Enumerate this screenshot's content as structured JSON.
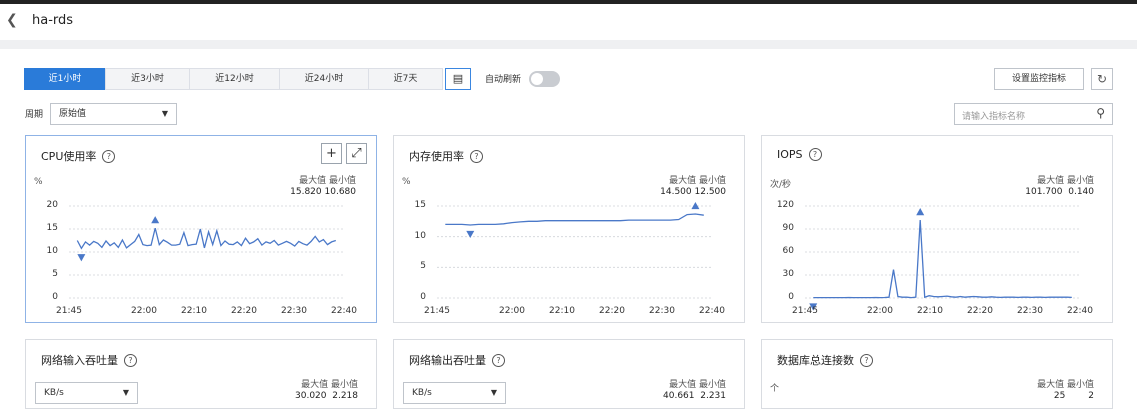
{
  "header": {
    "title": "ha-rds",
    "back_icon": "chevron-left-icon"
  },
  "toolbar": {
    "time_ranges": [
      "近1小时",
      "近3小时",
      "近12小时",
      "近24小时",
      "近7天"
    ],
    "active_range": "近1小时",
    "auto_refresh_label": "自动刷新",
    "auto_refresh_on": false,
    "settings_label": "设置监控指标",
    "period_label": "周期",
    "period_value": "原始值",
    "search_placeholder": "请输入指标名称"
  },
  "labels": {
    "max": "最大值",
    "min": "最小值"
  },
  "cards": [
    {
      "title": "CPU使用率",
      "unit": "%",
      "max": "15.820",
      "min": "10.680",
      "chart_data": {
        "type": "line",
        "x_ticks": [
          "21:45",
          "22:00",
          "22:10",
          "22:20",
          "22:30",
          "22:40"
        ],
        "y_ticks": [
          "20",
          "15",
          "10",
          "5",
          "0"
        ],
        "ylim": [
          0,
          20
        ],
        "series": [
          {
            "values": [
              12.5,
              10.8,
              12.2,
              11.5,
              12.3,
              11.9,
              11.0,
              12.4,
              11.4,
              12.0,
              11.0,
              12.6,
              10.9,
              11.6,
              12.3,
              13.8,
              11.6,
              11.4,
              11.5,
              15.2,
              11.6,
              12.6,
              12.1,
              11.5,
              11.5,
              11.7,
              14.2,
              11.4,
              11.6,
              11.7,
              15.0,
              10.9,
              14.4,
              11.6,
              14.6,
              11.4,
              12.4,
              11.7,
              11.6,
              12.2,
              11.4,
              13.0,
              11.8,
              12.2,
              12.9,
              11.5,
              12.2,
              11.9,
              12.5,
              11.5,
              11.9,
              12.3,
              11.9,
              11.3,
              12.3,
              11.8,
              11.5,
              12.3,
              13.4,
              12.2,
              12.7,
              11.6,
              12.2,
              12.5
            ]
          }
        ],
        "max_marker_x": "22:06",
        "min_marker_x": "21:49",
        "grid": "dashed-horizontal"
      }
    },
    {
      "title": "内存使用率",
      "unit": "%",
      "max": "14.500",
      "min": "12.500",
      "chart_data": {
        "type": "line",
        "x_ticks": [
          "21:45",
          "22:00",
          "22:10",
          "22:20",
          "22:30",
          "22:40"
        ],
        "y_ticks": [
          "15",
          "10",
          "5",
          "0"
        ],
        "ylim": [
          0,
          15
        ],
        "series": [
          {
            "values": [
              12.0,
              12.0,
              12.0,
              11.9,
              12.0,
              12.0,
              12.0,
              12.1,
              12.3,
              12.4,
              12.5,
              12.5,
              12.6,
              12.6,
              12.6,
              12.6,
              12.6,
              12.6,
              12.6,
              12.6,
              12.6,
              12.6,
              12.7,
              12.7,
              12.7,
              12.7,
              12.7,
              12.7,
              12.8,
              13.6,
              13.7,
              13.5
            ]
          }
        ],
        "max_marker_x": "22:40",
        "min_marker_x": "21:57",
        "grid": "dashed-horizontal"
      }
    },
    {
      "title": "IOPS",
      "unit": "次/秒",
      "max": "101.700",
      "min": "0.140",
      "chart_data": {
        "type": "line",
        "x_ticks": [
          "21:45",
          "22:00",
          "22:10",
          "22:20",
          "22:30",
          "22:40"
        ],
        "y_ticks": [
          "120",
          "90",
          "60",
          "30",
          "0"
        ],
        "ylim": [
          0,
          120
        ],
        "series": [
          {
            "values": [
              0.5,
              0.5,
              0.5,
              0.5,
              0.5,
              0.5,
              0.5,
              0.5,
              0.6,
              0.5,
              0.5,
              0.5,
              0.5,
              0.5,
              0.6,
              0.5,
              0.7,
              1.0,
              37,
              2,
              1,
              1,
              0.5,
              1,
              101.7,
              1,
              3,
              2,
              1.5,
              2,
              2.5,
              1.5,
              1,
              2,
              1,
              1.5,
              2,
              1.5,
              1,
              1,
              1.5,
              1,
              0.8,
              1,
              1.2,
              1,
              0.8,
              1,
              1,
              0.8,
              1,
              1,
              0.8,
              1,
              1,
              1,
              1,
              1,
              0.8
            ]
          }
        ],
        "max_marker_x": "22:05",
        "min_marker_x": "21:55",
        "grid": "dashed-horizontal"
      }
    },
    {
      "title": "网络输入吞吐量",
      "select_value": "KB/s",
      "max": "30.020",
      "min": "2.218"
    },
    {
      "title": "网络输出吞吐量",
      "select_value": "KB/s",
      "max": "40.661",
      "min": "2.231"
    },
    {
      "title": "数据库总连接数",
      "unit": "个",
      "max": "25",
      "min": "2"
    }
  ],
  "colors": {
    "accent": "#2a7bd9",
    "line": "#4a78c8"
  }
}
